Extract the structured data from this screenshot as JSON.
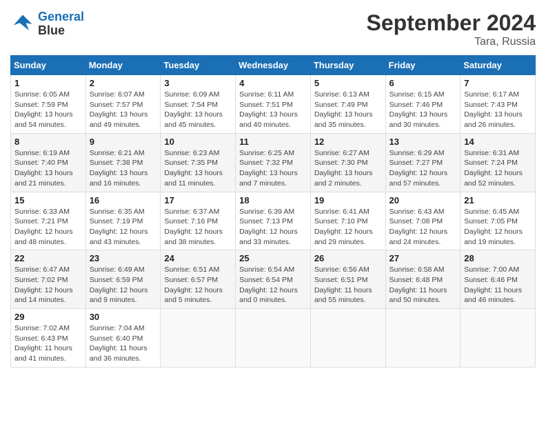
{
  "header": {
    "logo_line1": "General",
    "logo_line2": "Blue",
    "month": "September 2024",
    "location": "Tara, Russia"
  },
  "weekdays": [
    "Sunday",
    "Monday",
    "Tuesday",
    "Wednesday",
    "Thursday",
    "Friday",
    "Saturday"
  ],
  "weeks": [
    [
      {
        "day": "1",
        "info": "Sunrise: 6:05 AM\nSunset: 7:59 PM\nDaylight: 13 hours\nand 54 minutes."
      },
      {
        "day": "2",
        "info": "Sunrise: 6:07 AM\nSunset: 7:57 PM\nDaylight: 13 hours\nand 49 minutes."
      },
      {
        "day": "3",
        "info": "Sunrise: 6:09 AM\nSunset: 7:54 PM\nDaylight: 13 hours\nand 45 minutes."
      },
      {
        "day": "4",
        "info": "Sunrise: 6:11 AM\nSunset: 7:51 PM\nDaylight: 13 hours\nand 40 minutes."
      },
      {
        "day": "5",
        "info": "Sunrise: 6:13 AM\nSunset: 7:49 PM\nDaylight: 13 hours\nand 35 minutes."
      },
      {
        "day": "6",
        "info": "Sunrise: 6:15 AM\nSunset: 7:46 PM\nDaylight: 13 hours\nand 30 minutes."
      },
      {
        "day": "7",
        "info": "Sunrise: 6:17 AM\nSunset: 7:43 PM\nDaylight: 13 hours\nand 26 minutes."
      }
    ],
    [
      {
        "day": "8",
        "info": "Sunrise: 6:19 AM\nSunset: 7:40 PM\nDaylight: 13 hours\nand 21 minutes."
      },
      {
        "day": "9",
        "info": "Sunrise: 6:21 AM\nSunset: 7:38 PM\nDaylight: 13 hours\nand 16 minutes."
      },
      {
        "day": "10",
        "info": "Sunrise: 6:23 AM\nSunset: 7:35 PM\nDaylight: 13 hours\nand 11 minutes."
      },
      {
        "day": "11",
        "info": "Sunrise: 6:25 AM\nSunset: 7:32 PM\nDaylight: 13 hours\nand 7 minutes."
      },
      {
        "day": "12",
        "info": "Sunrise: 6:27 AM\nSunset: 7:30 PM\nDaylight: 13 hours\nand 2 minutes."
      },
      {
        "day": "13",
        "info": "Sunrise: 6:29 AM\nSunset: 7:27 PM\nDaylight: 12 hours\nand 57 minutes."
      },
      {
        "day": "14",
        "info": "Sunrise: 6:31 AM\nSunset: 7:24 PM\nDaylight: 12 hours\nand 52 minutes."
      }
    ],
    [
      {
        "day": "15",
        "info": "Sunrise: 6:33 AM\nSunset: 7:21 PM\nDaylight: 12 hours\nand 48 minutes."
      },
      {
        "day": "16",
        "info": "Sunrise: 6:35 AM\nSunset: 7:19 PM\nDaylight: 12 hours\nand 43 minutes."
      },
      {
        "day": "17",
        "info": "Sunrise: 6:37 AM\nSunset: 7:16 PM\nDaylight: 12 hours\nand 38 minutes."
      },
      {
        "day": "18",
        "info": "Sunrise: 6:39 AM\nSunset: 7:13 PM\nDaylight: 12 hours\nand 33 minutes."
      },
      {
        "day": "19",
        "info": "Sunrise: 6:41 AM\nSunset: 7:10 PM\nDaylight: 12 hours\nand 29 minutes."
      },
      {
        "day": "20",
        "info": "Sunrise: 6:43 AM\nSunset: 7:08 PM\nDaylight: 12 hours\nand 24 minutes."
      },
      {
        "day": "21",
        "info": "Sunrise: 6:45 AM\nSunset: 7:05 PM\nDaylight: 12 hours\nand 19 minutes."
      }
    ],
    [
      {
        "day": "22",
        "info": "Sunrise: 6:47 AM\nSunset: 7:02 PM\nDaylight: 12 hours\nand 14 minutes."
      },
      {
        "day": "23",
        "info": "Sunrise: 6:49 AM\nSunset: 6:59 PM\nDaylight: 12 hours\nand 9 minutes."
      },
      {
        "day": "24",
        "info": "Sunrise: 6:51 AM\nSunset: 6:57 PM\nDaylight: 12 hours\nand 5 minutes."
      },
      {
        "day": "25",
        "info": "Sunrise: 6:54 AM\nSunset: 6:54 PM\nDaylight: 12 hours\nand 0 minutes."
      },
      {
        "day": "26",
        "info": "Sunrise: 6:56 AM\nSunset: 6:51 PM\nDaylight: 11 hours\nand 55 minutes."
      },
      {
        "day": "27",
        "info": "Sunrise: 6:58 AM\nSunset: 6:48 PM\nDaylight: 11 hours\nand 50 minutes."
      },
      {
        "day": "28",
        "info": "Sunrise: 7:00 AM\nSunset: 6:46 PM\nDaylight: 11 hours\nand 46 minutes."
      }
    ],
    [
      {
        "day": "29",
        "info": "Sunrise: 7:02 AM\nSunset: 6:43 PM\nDaylight: 11 hours\nand 41 minutes."
      },
      {
        "day": "30",
        "info": "Sunrise: 7:04 AM\nSunset: 6:40 PM\nDaylight: 11 hours\nand 36 minutes."
      },
      null,
      null,
      null,
      null,
      null
    ]
  ]
}
